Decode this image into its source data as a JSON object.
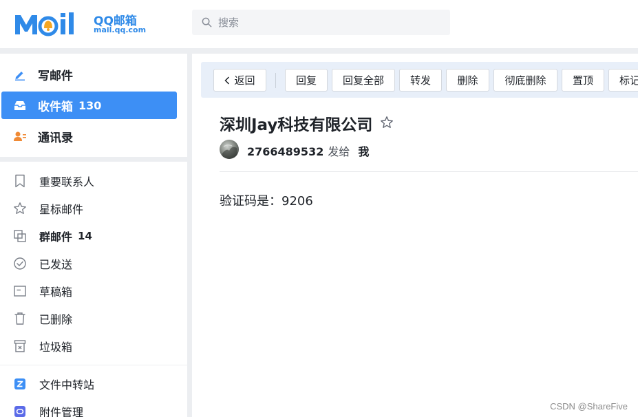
{
  "header": {
    "logo_text_main": "QQ邮箱",
    "logo_text_sub": "mail.qq.com",
    "search_placeholder": "搜索"
  },
  "sidebar": {
    "primary": [
      {
        "label": "写邮件",
        "count": "",
        "icon": "pen-icon"
      },
      {
        "label": "收件箱",
        "count": "130",
        "icon": "inbox-icon",
        "active": true
      },
      {
        "label": "通讯录",
        "count": "",
        "icon": "contacts-icon"
      }
    ],
    "folders": [
      {
        "label": "重要联系人",
        "count": "",
        "icon": "bookmark-icon"
      },
      {
        "label": "星标邮件",
        "count": "",
        "icon": "star-icon"
      },
      {
        "label": "群邮件",
        "count": "14",
        "icon": "group-icon"
      },
      {
        "label": "已发送",
        "count": "",
        "icon": "check-circle-icon"
      },
      {
        "label": "草稿箱",
        "count": "",
        "icon": "draft-icon"
      },
      {
        "label": "已删除",
        "count": "",
        "icon": "trash-icon"
      },
      {
        "label": "垃圾箱",
        "count": "",
        "icon": "spam-icon"
      }
    ],
    "apps": [
      {
        "label": "文件中转站",
        "icon": "file-transfer-icon"
      },
      {
        "label": "附件管理",
        "icon": "attachment-manager-icon"
      }
    ]
  },
  "toolbar": {
    "back": "返回",
    "reply": "回复",
    "reply_all": "回复全部",
    "forward": "转发",
    "delete": "删除",
    "delete_permanently": "彻底删除",
    "pin": "置顶",
    "mark": "标记"
  },
  "mail": {
    "subject": "深圳Jay科技有限公司",
    "sender": "2766489532",
    "sent_to_label": "发给",
    "recipient": "我",
    "body": "验证码是：9206"
  },
  "watermark": "CSDN @ShareFive",
  "colors": {
    "accent": "#3d8ff5",
    "toolbar_bg": "#e8eff9",
    "separator": "#eceef1",
    "logo_blue": "#2f8ae8",
    "logo_orange": "#f5a623"
  }
}
